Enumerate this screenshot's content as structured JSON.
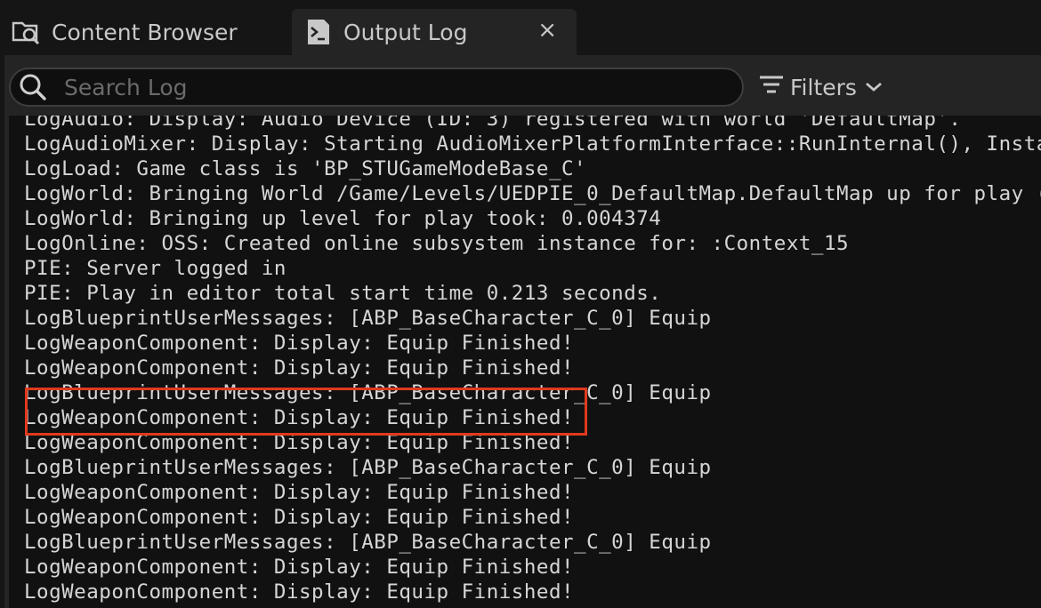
{
  "tabs": [
    {
      "label": "Content Browser",
      "icon": "content-browser-icon",
      "active": false
    },
    {
      "label": "Output Log",
      "icon": "output-log-icon",
      "active": true,
      "close": "×"
    }
  ],
  "toolbar": {
    "search_placeholder": "Search Log",
    "filters_label": "Filters"
  },
  "log": {
    "lines": [
      "LogAudio: Display: Audio Device (ID: 3) registered with world 'DefaultMap'.",
      "LogAudioMixer: Display: Starting AudioMixerPlatformInterface::RunInternal(), Insta",
      "LogLoad: Game class is 'BP_STUGameModeBase_C'",
      "LogWorld: Bringing World /Game/Levels/UEDPIE_0_DefaultMap.DefaultMap up for play (",
      "LogWorld: Bringing up level for play took: 0.004374",
      "LogOnline: OSS: Created online subsystem instance for: :Context_15",
      "PIE: Server logged in",
      "PIE: Play in editor total start time 0.213 seconds.",
      "LogBlueprintUserMessages: [ABP_BaseCharacter_C_0] Equip",
      "LogWeaponComponent: Display: Equip Finished!",
      "LogWeaponComponent: Display: Equip Finished!",
      "LogBlueprintUserMessages: [ABP_BaseCharacter_C_0] Equip",
      "LogWeaponComponent: Display: Equip Finished!",
      "LogWeaponComponent: Display: Equip Finished!",
      "LogBlueprintUserMessages: [ABP_BaseCharacter_C_0] Equip",
      "LogWeaponComponent: Display: Equip Finished!",
      "LogWeaponComponent: Display: Equip Finished!",
      "LogBlueprintUserMessages: [ABP_BaseCharacter_C_0] Equip",
      "LogWeaponComponent: Display: Equip Finished!",
      "LogWeaponComponent: Display: Equip Finished!"
    ],
    "highlighted_lines": [
      9,
      10
    ]
  },
  "colors": {
    "highlight": "#e03a1e",
    "log_text": "#d6d6d6",
    "log_background": "#111111"
  }
}
